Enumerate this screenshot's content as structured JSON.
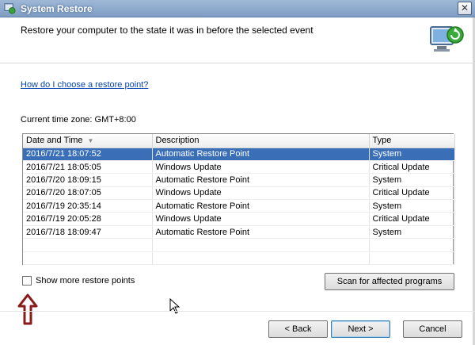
{
  "window": {
    "title": "System Restore"
  },
  "header": {
    "heading": "Restore your computer to the state it was in before the selected event"
  },
  "help_link": "How do I choose a restore point?",
  "timezone": "Current time zone: GMT+8:00",
  "table": {
    "columns": [
      "Date and Time",
      "Description",
      "Type"
    ],
    "rows": [
      [
        "2016/7/21 18:07:52",
        "Automatic Restore Point",
        "System"
      ],
      [
        "2016/7/21 18:05:05",
        "Windows Update",
        "Critical Update"
      ],
      [
        "2016/7/20 18:09:15",
        "Automatic Restore Point",
        "System"
      ],
      [
        "2016/7/20 18:07:05",
        "Windows Update",
        "Critical Update"
      ],
      [
        "2016/7/19 20:35:14",
        "Automatic Restore Point",
        "System"
      ],
      [
        "2016/7/19 20:05:28",
        "Windows Update",
        "Critical Update"
      ],
      [
        "2016/7/18 18:09:47",
        "Automatic Restore Point",
        "System"
      ]
    ],
    "selected_row": 0
  },
  "checkbox": {
    "label": "Show more restore points",
    "checked": false
  },
  "buttons": {
    "scan": "Scan for affected programs",
    "back": "< Back",
    "next": "Next >",
    "cancel": "Cancel",
    "close": "✕"
  },
  "colors": {
    "selection": "#3a6fb8",
    "link": "#0645ad",
    "annotation_arrow": "#8b1a1a"
  },
  "icons": [
    "system-restore-app-icon",
    "restore-computer-graphic",
    "close-icon",
    "sort-down-icon",
    "up-arrow-annotation-icon",
    "mouse-cursor-icon"
  ]
}
